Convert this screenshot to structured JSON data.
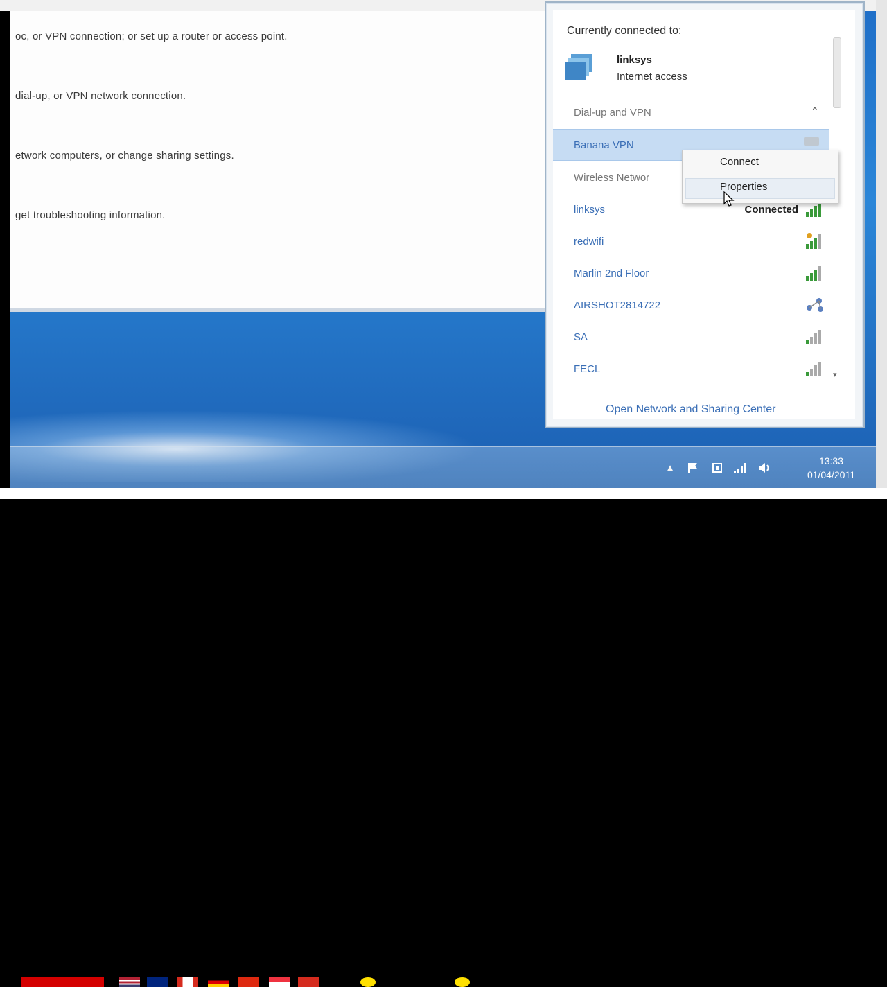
{
  "control_panel": {
    "lines": [
      "oc, or VPN connection; or set up a router or access point.",
      "dial-up, or VPN network connection.",
      "etwork computers, or change sharing settings.",
      "get troubleshooting information."
    ]
  },
  "flyout": {
    "currently_connected_label": "Currently connected to:",
    "current_network": {
      "name": "linksys",
      "access": "Internet access"
    },
    "section_header": "Dial-up and VPN",
    "vpn_name": "Banana VPN",
    "wireless_label": "Wireless Networ",
    "networks": [
      {
        "name": "linksys",
        "status": "Connected"
      },
      {
        "name": "redwifi",
        "status": ""
      },
      {
        "name": "Marlin 2nd Floor",
        "status": ""
      },
      {
        "name": "AIRSHOT2814722",
        "status": ""
      },
      {
        "name": "SA",
        "status": ""
      },
      {
        "name": "FECL",
        "status": ""
      }
    ],
    "open_center_link": "Open Network and Sharing Center"
  },
  "context_menu": {
    "items": [
      "Connect",
      "Properties"
    ]
  },
  "taskbar": {
    "time": "13:33",
    "date": "01/04/2011",
    "tray_up_icon": "▲"
  },
  "colors": {
    "link_blue": "#3b6fb6",
    "selection_blue": "#c6dcf3",
    "desktop_blue": "#2a86d8"
  },
  "icons": [
    "network-icon",
    "wifi-bars-icon",
    "vpn-icon",
    "collapse-icon",
    "flag-icon",
    "speaker-icon",
    "power-icon"
  ]
}
